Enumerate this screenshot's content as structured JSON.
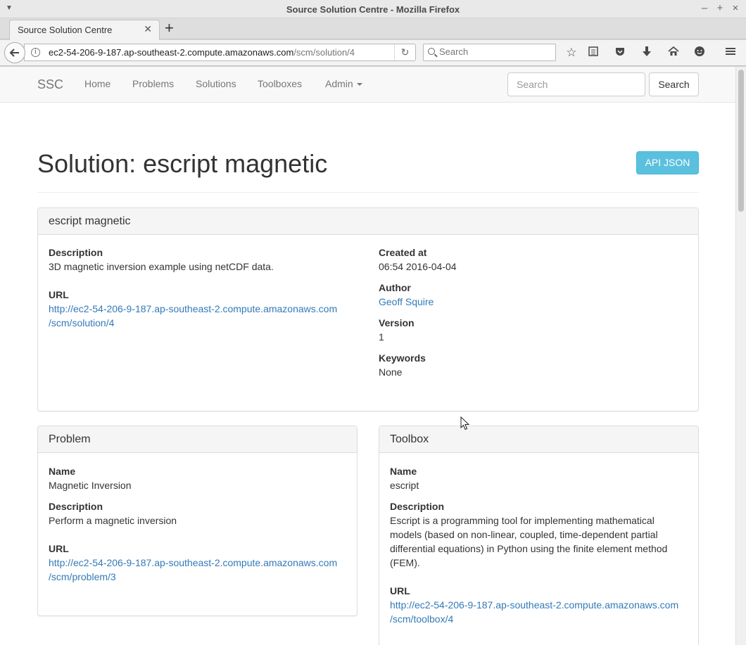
{
  "window": {
    "title": "Source Solution Centre - Mozilla Firefox",
    "controls": [
      "–",
      "+",
      "×"
    ]
  },
  "tab": {
    "label": "Source Solution Centre"
  },
  "urlbar": {
    "url_host": "ec2-54-206-9-187.ap-southeast-2.compute.amazonaws.com",
    "url_path": "/scm/solution/4"
  },
  "ff_search": {
    "placeholder": "Search"
  },
  "site": {
    "brand": "SSC",
    "nav": [
      "Home",
      "Problems",
      "Solutions",
      "Toolboxes",
      "Admin"
    ],
    "search_placeholder": "Search",
    "search_button": "Search"
  },
  "page": {
    "title": "Solution: escript magnetic",
    "api_button": "API JSON"
  },
  "solution": {
    "heading": "escript magnetic",
    "description_label": "Description",
    "description": "3D magnetic inversion example using netCDF data.",
    "url_label": "URL",
    "url_line1": "http://ec2-54-206-9-187.ap-southeast-2.compute.amazonaws.com",
    "url_line2": "/scm/solution/4",
    "created_label": "Created at",
    "created": "06:54 2016-04-04",
    "author_label": "Author",
    "author": "Geoff Squire",
    "version_label": "Version",
    "version": "1",
    "keywords_label": "Keywords",
    "keywords": "None"
  },
  "problem": {
    "heading": "Problem",
    "name_label": "Name",
    "name": "Magnetic Inversion",
    "description_label": "Description",
    "description": "Perform a magnetic inversion",
    "url_label": "URL",
    "url_line1": "http://ec2-54-206-9-187.ap-southeast-2.compute.amazonaws.com",
    "url_line2": "/scm/problem/3"
  },
  "toolbox": {
    "heading": "Toolbox",
    "name_label": "Name",
    "name": "escript",
    "description_label": "Description",
    "description_lines": [
      "Escript is a programming tool for implementing mathematical",
      "models (based on non-linear, coupled, time-dependent partial",
      "differential equations) in Python using the finite element method",
      "(FEM)."
    ],
    "url_label": "URL",
    "url_line1": "http://ec2-54-206-9-187.ap-southeast-2.compute.amazonaws.com",
    "url_line2": "/scm/toolbox/4"
  },
  "colors": {
    "link": "#337ab7",
    "info_button": "#5bc0de",
    "navbar_bg": "#f8f8f8"
  }
}
